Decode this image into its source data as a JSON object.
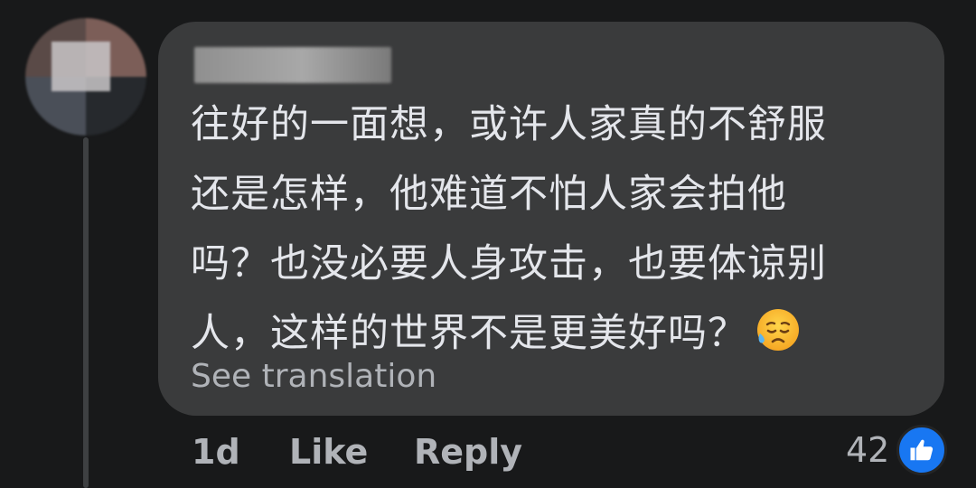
{
  "comment": {
    "lines": [
      "往好的一面想，或许人家真的不舒服",
      "还是怎样，他难道不怕人家会拍他",
      "吗？也没必要人身攻击，也要体谅别",
      "人，这样的世界不是更美好吗？"
    ],
    "emoji": "sad-relieved-face-icon",
    "see_translation": "See translation"
  },
  "actions": {
    "time": "1d",
    "like": "Like",
    "reply": "Reply"
  },
  "reactions": {
    "count": "42",
    "icon": "thumbs-up-icon"
  },
  "colors": {
    "background": "#18191a",
    "bubble": "#3a3b3c",
    "text": "#e4e6eb",
    "secondary": "#b0b3b8",
    "like_blue": "#1877f2"
  }
}
